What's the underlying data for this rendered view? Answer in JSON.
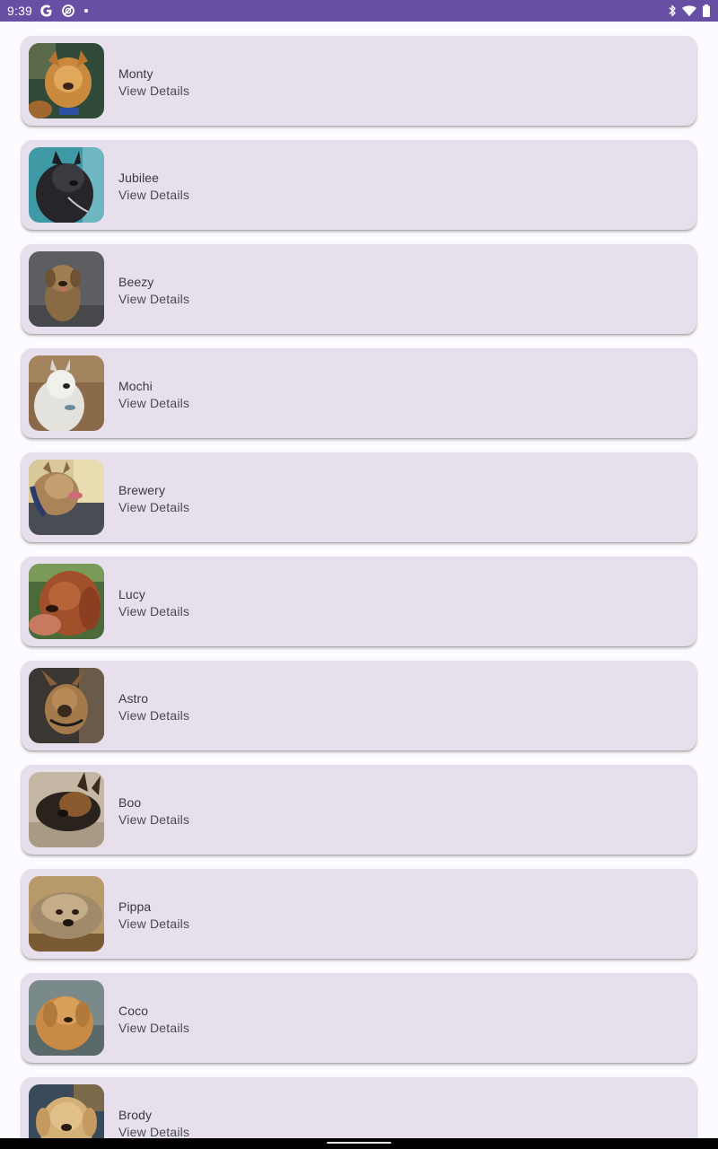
{
  "status_bar": {
    "time": "9:39",
    "background": "#6750a4",
    "left_icons": [
      "google-icon",
      "data-saver-icon",
      "dot-icon"
    ],
    "right_icons": [
      "bluetooth-icon",
      "wifi-icon",
      "battery-icon"
    ]
  },
  "dogs": [
    {
      "name": "Monty",
      "action": "View Details",
      "photo": "dog-photo-monty"
    },
    {
      "name": "Jubilee",
      "action": "View Details",
      "photo": "dog-photo-jubilee"
    },
    {
      "name": "Beezy",
      "action": "View Details",
      "photo": "dog-photo-beezy"
    },
    {
      "name": "Mochi",
      "action": "View Details",
      "photo": "dog-photo-mochi"
    },
    {
      "name": "Brewery",
      "action": "View Details",
      "photo": "dog-photo-brewery"
    },
    {
      "name": "Lucy",
      "action": "View Details",
      "photo": "dog-photo-lucy"
    },
    {
      "name": "Astro",
      "action": "View Details",
      "photo": "dog-photo-astro"
    },
    {
      "name": "Boo",
      "action": "View Details",
      "photo": "dog-photo-boo"
    },
    {
      "name": "Pippa",
      "action": "View Details",
      "photo": "dog-photo-pippa"
    },
    {
      "name": "Coco",
      "action": "View Details",
      "photo": "dog-photo-coco"
    },
    {
      "name": "Brody",
      "action": "View Details",
      "photo": "dog-photo-brody"
    }
  ],
  "colors": {
    "card_background": "#e7e0ec",
    "page_background": "#fdfbff",
    "accent": "#6750a4"
  }
}
